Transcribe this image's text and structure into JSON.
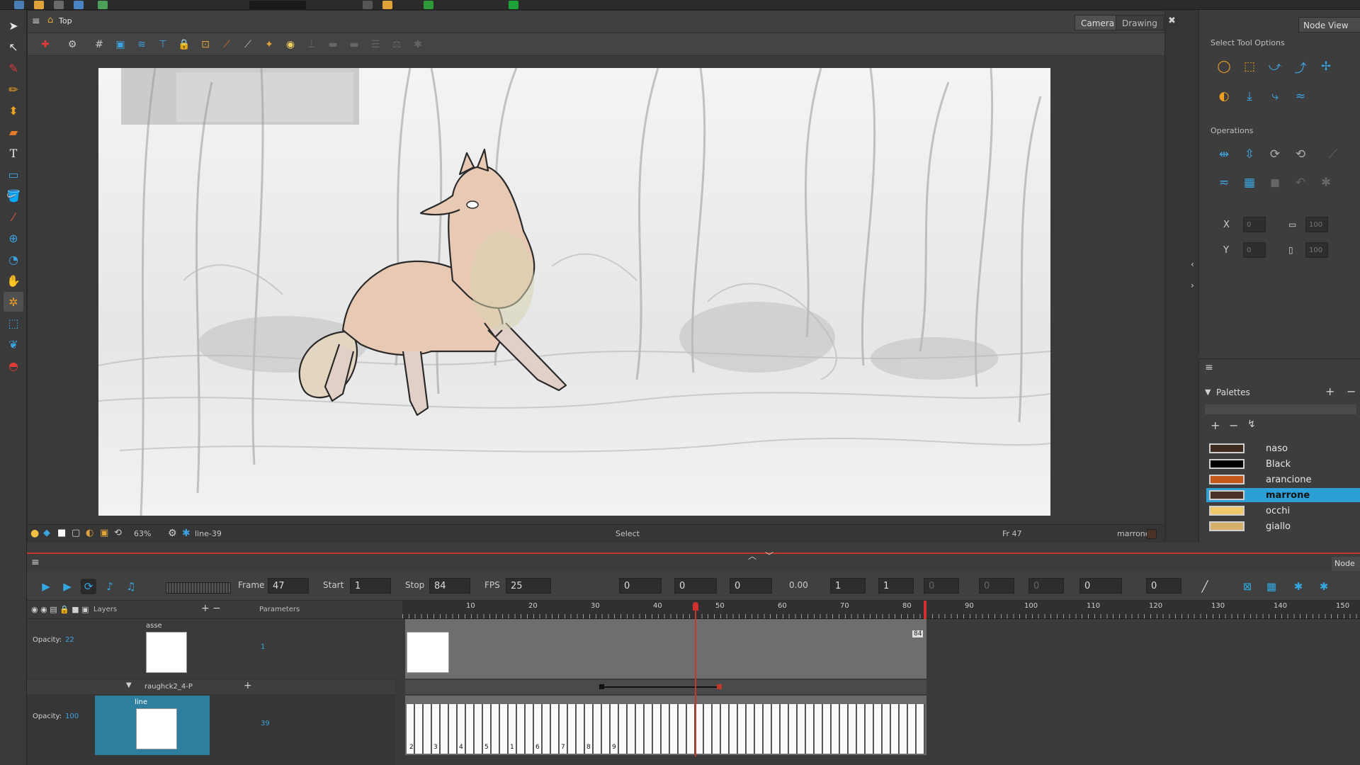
{
  "camera_view": {
    "breadcrumb": "Top",
    "tab_camera": "Camera",
    "tab_drawing": "Drawing",
    "right_tab": "Node View",
    "status": {
      "zoom": "63%",
      "drawing_name": "line-39",
      "tool": "Select",
      "frame": "Fr 47",
      "color_name": "marrone"
    }
  },
  "tool_properties": {
    "title": "Select Tool Options",
    "operations_title": "Operations",
    "x_value": "0",
    "y_value": "0",
    "width_value": "100",
    "height_value": "100"
  },
  "palettes": {
    "title": "Palettes",
    "colors": [
      {
        "name": "naso",
        "color": "#3f2a22"
      },
      {
        "name": "Black",
        "color": "#000000"
      },
      {
        "name": "arancione",
        "color": "#c4571a"
      },
      {
        "name": "marrone",
        "color": "#4a3326"
      },
      {
        "name": "occhi",
        "color": "#f0c86a"
      },
      {
        "name": "giallo",
        "color": "#d6b06a"
      }
    ],
    "selected": "marrone"
  },
  "timeline": {
    "frame_label": "Frame",
    "frame_value": "47",
    "start_label": "Start",
    "start_value": "1",
    "stop_label": "Stop",
    "stop_value": "84",
    "fps_label": "FPS",
    "fps_value": "25",
    "field_values": [
      "0",
      "0",
      "0"
    ],
    "zoom_value": "0.00",
    "values_b": [
      "1",
      "1",
      "0",
      "0",
      "0",
      "0",
      "0"
    ],
    "right_tab": "Node",
    "layers_label": "Layers",
    "parameters_label": "Parameters",
    "ruler_numbers": [
      "10",
      "20",
      "30",
      "40",
      "50",
      "60",
      "70",
      "80",
      "90",
      "100",
      "110",
      "120",
      "130",
      "140",
      "150"
    ],
    "end_marker": "84",
    "layers": [
      {
        "name": "asse",
        "opacity_label": "Opacity:",
        "opacity": "22",
        "param": "1"
      },
      {
        "name": "raughck2_4-P"
      },
      {
        "name": "line",
        "opacity_label": "Opacity:",
        "opacity": "100",
        "param": "39"
      }
    ],
    "cell_numbers": [
      "2",
      "3",
      "4",
      "5",
      "1",
      "6",
      "7",
      "8",
      "9"
    ]
  },
  "accent": "#2b9fd6"
}
